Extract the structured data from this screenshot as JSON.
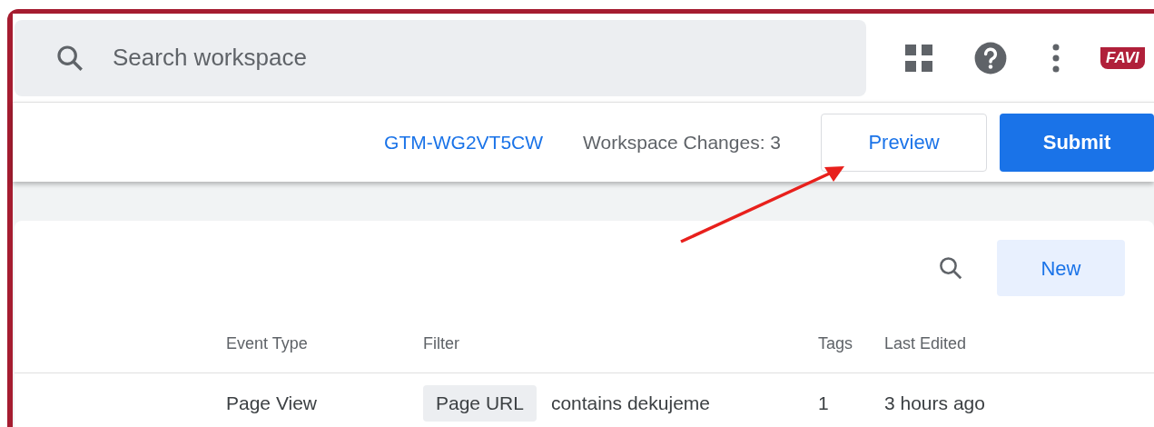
{
  "search": {
    "placeholder": "Search workspace"
  },
  "logo": {
    "text": "FAVI"
  },
  "workspace_bar": {
    "container_id": "GTM-WG2VT5CW",
    "changes": "Workspace Changes: 3",
    "buttons": [
      {
        "label": "Preview",
        "kind": "outline"
      },
      {
        "label": "Submit",
        "kind": "primary"
      }
    ]
  },
  "card": {
    "new_button": "New",
    "table": {
      "columns": [
        "Event Type",
        "Filter",
        "Tags",
        "Last Edited"
      ],
      "rows": [
        {
          "event_type": "Page View",
          "filter_chip": "Page URL",
          "filter_text": "contains dekujeme",
          "tags": "1",
          "last_edited": "3 hours ago"
        }
      ]
    }
  }
}
